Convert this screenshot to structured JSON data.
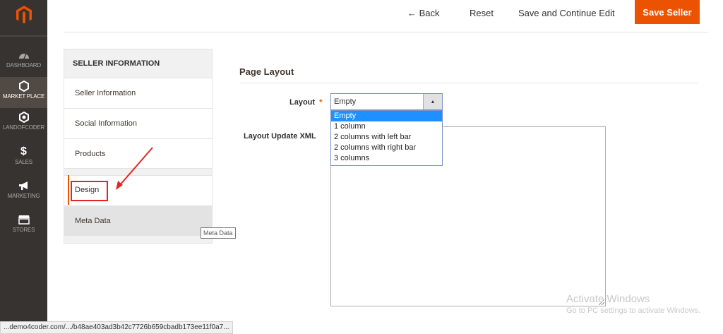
{
  "sidebar": {
    "logo": "magento-logo",
    "items": [
      {
        "label": "DASHBOARD",
        "icon": "speedometer-icon"
      },
      {
        "label": "MARKET PLACE",
        "icon": "hexagon-icon"
      },
      {
        "label": "LANDOFCODER",
        "icon": "gear-hex-icon"
      },
      {
        "label": "SALES",
        "icon": "dollar-icon"
      },
      {
        "label": "MARKETING",
        "icon": "megaphone-icon"
      },
      {
        "label": "STORES",
        "icon": "storefront-icon"
      }
    ]
  },
  "toolbar": {
    "back_label": "← Back",
    "reset_label": "Reset",
    "save_continue_label": "Save and Continue Edit",
    "save_label": "Save Seller"
  },
  "tabs": {
    "title": "SELLER INFORMATION",
    "items": [
      {
        "label": "Seller Information"
      },
      {
        "label": "Social Information"
      },
      {
        "label": "Products"
      },
      {
        "label": "Design"
      },
      {
        "label": "Meta Data"
      }
    ],
    "active": "Design"
  },
  "main": {
    "section_title": "Page Layout",
    "layout_label": "Layout",
    "required_marker": "*",
    "layout_value": "Empty",
    "layout_options": [
      "Empty",
      "1 column",
      "2 columns with left bar",
      "2 columns with right bar",
      "3 columns"
    ],
    "layout_update_label": "Layout Update XML",
    "layout_update_value": ""
  },
  "tooltip": "Meta Data",
  "watermark": {
    "title": "Activate Windows",
    "subtitle": "Go to PC settings to activate Windows."
  },
  "status_url": "...demo4coder.com/.../b48ae403ad3b42c7726b659cbadb173ee11f0a7...",
  "colors": {
    "sidebar_bg": "#373330",
    "accent": "#eb5202",
    "annotation_red": "#e22626",
    "select_highlight": "#1e90ff"
  }
}
